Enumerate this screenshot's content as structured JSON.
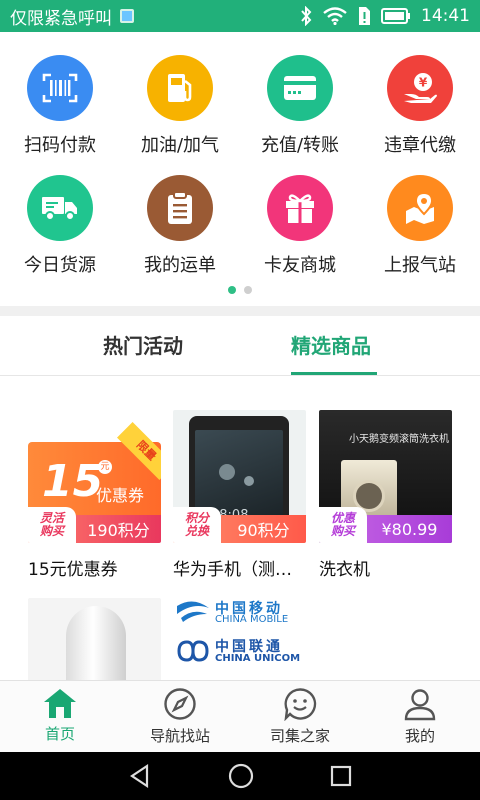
{
  "status_bar": {
    "carrier": "仅限紧急呼叫",
    "time": "14:41"
  },
  "quick_grid": {
    "items": [
      {
        "label": "扫码付款",
        "icon": "scan-barcode-icon",
        "color": "#3a8cf2"
      },
      {
        "label": "加油/加气",
        "icon": "fuel-pump-icon",
        "color": "#f7b200"
      },
      {
        "label": "充值/转账",
        "icon": "card-icon",
        "color": "#1fbf8c"
      },
      {
        "label": "违章代缴",
        "icon": "hand-yen-icon",
        "color": "#f0413b"
      },
      {
        "label": "今日货源",
        "icon": "truck-icon",
        "color": "#20c58f"
      },
      {
        "label": "我的运单",
        "icon": "clipboard-icon",
        "color": "#9a5a34"
      },
      {
        "label": "卡友商城",
        "icon": "gift-icon",
        "color": "#f2357a"
      },
      {
        "label": "上报气站",
        "icon": "map-pin-icon",
        "color": "#ff8a1e"
      }
    ],
    "page_count": 2,
    "active_page": 1
  },
  "tabs": [
    {
      "label": "热门活动",
      "active": false
    },
    {
      "label": "精选商品",
      "active": true
    }
  ],
  "products": [
    {
      "name": "15元优惠券",
      "tag": [
        "灵活",
        "购买"
      ],
      "price": "190积分",
      "thumb_text": {
        "amount": "15",
        "unit": "元",
        "word": "优惠券",
        "ribbon": "限量"
      }
    },
    {
      "name": "华为手机（测试...",
      "tag": [
        "积分",
        "兑换"
      ],
      "price": "90积分",
      "thumb_text": {
        "clock": "08:08"
      }
    },
    {
      "name": "洗衣机",
      "tag": [
        "优惠",
        "购买"
      ],
      "price": "¥80.99",
      "thumb_text": {
        "headline": "小天鹅变频滚筒洗衣机"
      }
    },
    {
      "name": "",
      "tag": [],
      "price": "",
      "thumb_text": {}
    },
    {
      "name": "",
      "tag": [],
      "price": "",
      "thumb_text": {
        "cm": "中国移动",
        "cm_en": "CHINA MOBILE",
        "cu": "中国联通",
        "cu_en": "CHINA UNICOM"
      }
    }
  ],
  "bottom_nav": [
    {
      "label": "首页",
      "icon": "home-icon",
      "active": true
    },
    {
      "label": "导航找站",
      "icon": "compass-icon",
      "active": false
    },
    {
      "label": "司集之家",
      "icon": "chat-smile-icon",
      "active": false
    },
    {
      "label": "我的",
      "icon": "user-icon",
      "active": false
    }
  ],
  "colors": {
    "brand": "#21b07a",
    "accent": "#21a676",
    "tag_gradient_start": "#ff7a6a",
    "tag_gradient_end": "#ff3e7a"
  }
}
